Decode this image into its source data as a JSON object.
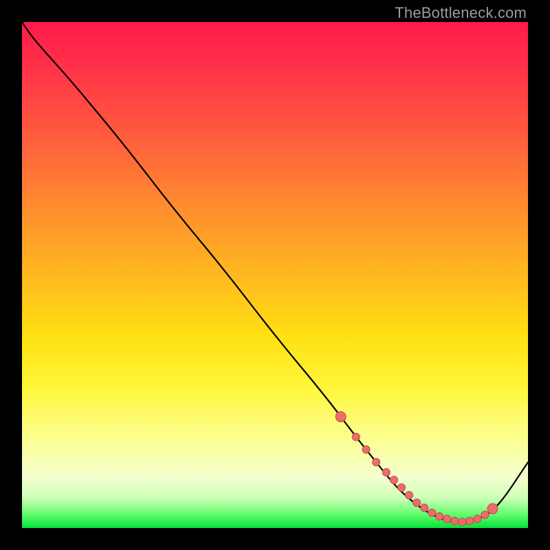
{
  "attribution": "TheBottleneck.com",
  "colors": {
    "curve": "#000000",
    "dot_fill": "#ef6b6b",
    "dot_stroke": "#bf4a4a",
    "background_black": "#000000"
  },
  "gradient_stops": [
    {
      "pos": 0.0,
      "hex": "#ff1a4b"
    },
    {
      "pos": 0.08,
      "hex": "#ff2f49"
    },
    {
      "pos": 0.22,
      "hex": "#ff5a3e"
    },
    {
      "pos": 0.36,
      "hex": "#ff8b2f"
    },
    {
      "pos": 0.5,
      "hex": "#ffb820"
    },
    {
      "pos": 0.62,
      "hex": "#ffe012"
    },
    {
      "pos": 0.72,
      "hex": "#fff638"
    },
    {
      "pos": 0.82,
      "hex": "#fcff8e"
    },
    {
      "pos": 0.9,
      "hex": "#f3ffcf"
    },
    {
      "pos": 0.94,
      "hex": "#cfffb8"
    },
    {
      "pos": 0.97,
      "hex": "#6dff73"
    },
    {
      "pos": 1.0,
      "hex": "#06e23a"
    }
  ],
  "chart_data": {
    "type": "line",
    "title": "",
    "xlabel": "",
    "ylabel": "",
    "xrange": [
      0,
      100
    ],
    "yrange": [
      0,
      100
    ],
    "note": "No axis ticks or numeric labels are rendered; x/y are normalized 0–100 estimates read from pixel positions.",
    "series": [
      {
        "name": "curve",
        "x": [
          0,
          2,
          6,
          10,
          20,
          30,
          40,
          50,
          60,
          66,
          70,
          74,
          78,
          82,
          86,
          90,
          94,
          100
        ],
        "y": [
          100,
          97,
          92.5,
          88,
          76,
          63,
          51,
          38,
          26,
          18,
          13,
          8,
          4.5,
          2,
          1,
          1.5,
          4,
          13
        ]
      }
    ],
    "highlight_points": {
      "name": "dots",
      "x": [
        63,
        66,
        68,
        70,
        72,
        73.5,
        75,
        76.5,
        78,
        79.5,
        81,
        82.5,
        84,
        85.5,
        87,
        88.5,
        90,
        91.5,
        93
      ],
      "y": [
        22,
        18,
        15.5,
        13,
        11,
        9.5,
        8,
        6.5,
        5,
        4,
        3,
        2.3,
        1.8,
        1.4,
        1.2,
        1.4,
        1.8,
        2.6,
        3.8
      ]
    }
  }
}
